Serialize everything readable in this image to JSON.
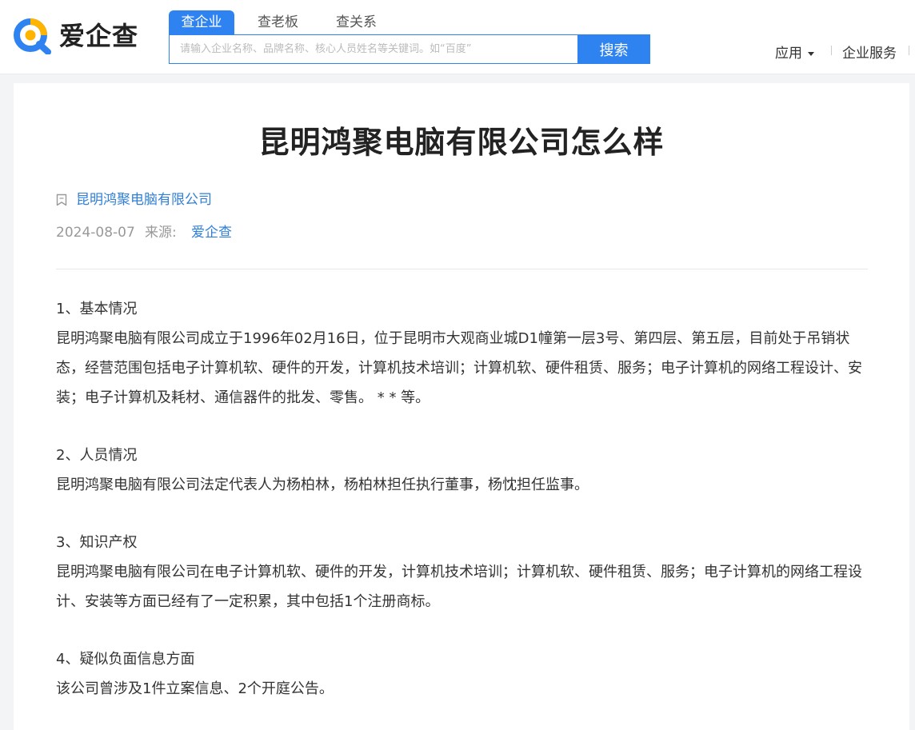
{
  "header": {
    "logo_text": "爱企查",
    "tabs": [
      {
        "label": "查企业",
        "active": true
      },
      {
        "label": "查老板",
        "active": false
      },
      {
        "label": "查关系",
        "active": false
      }
    ],
    "search": {
      "placeholder": "请输入企业名称、品牌名称、核心人员姓名等关键词。如“百度”",
      "value": "",
      "button_label": "搜索"
    },
    "nav": {
      "app_label": "应用",
      "service_label": "企业服务"
    }
  },
  "article": {
    "title": "昆明鸿聚电脑有限公司怎么样",
    "company_tag": "昆明鸿聚电脑有限公司",
    "date": "2024-08-07",
    "source_label": "来源:",
    "source": "爱企查",
    "sections": [
      {
        "heading": "1、基本情况",
        "body": "昆明鸿聚电脑有限公司成立于1996年02月16日，位于昆明市大观商业城D1幢第一层3号、第四层、第五层，目前处于吊销状态，经营范围包括电子计算机软、硬件的开发，计算机技术培训；计算机软、硬件租赁、服务；电子计算机的网络工程设计、安装；电子计算机及耗材、通信器件的批发、零售。 * * 等。"
      },
      {
        "heading": "2、人员情况",
        "body": "昆明鸿聚电脑有限公司法定代表人为杨柏林，杨柏林担任执行董事，杨忱担任监事。"
      },
      {
        "heading": "3、知识产权",
        "body": "昆明鸿聚电脑有限公司在电子计算机软、硬件的开发，计算机技术培训；计算机软、硬件租赁、服务；电子计算机的网络工程设计、安装等方面已经有了一定积累，其中包括1个注册商标。"
      },
      {
        "heading": "4、疑似负面信息方面",
        "body": "该公司曾涉及1件立案信息、2个开庭公告。"
      }
    ]
  },
  "colors": {
    "accent": "#2f83f0",
    "link": "#2f7fd9",
    "logo_orange": "#ffb400"
  },
  "icons": {
    "logo": "aiqicha-magnifier-logo",
    "tag": "bookmark-icon",
    "dropdown": "caret-down-icon"
  }
}
